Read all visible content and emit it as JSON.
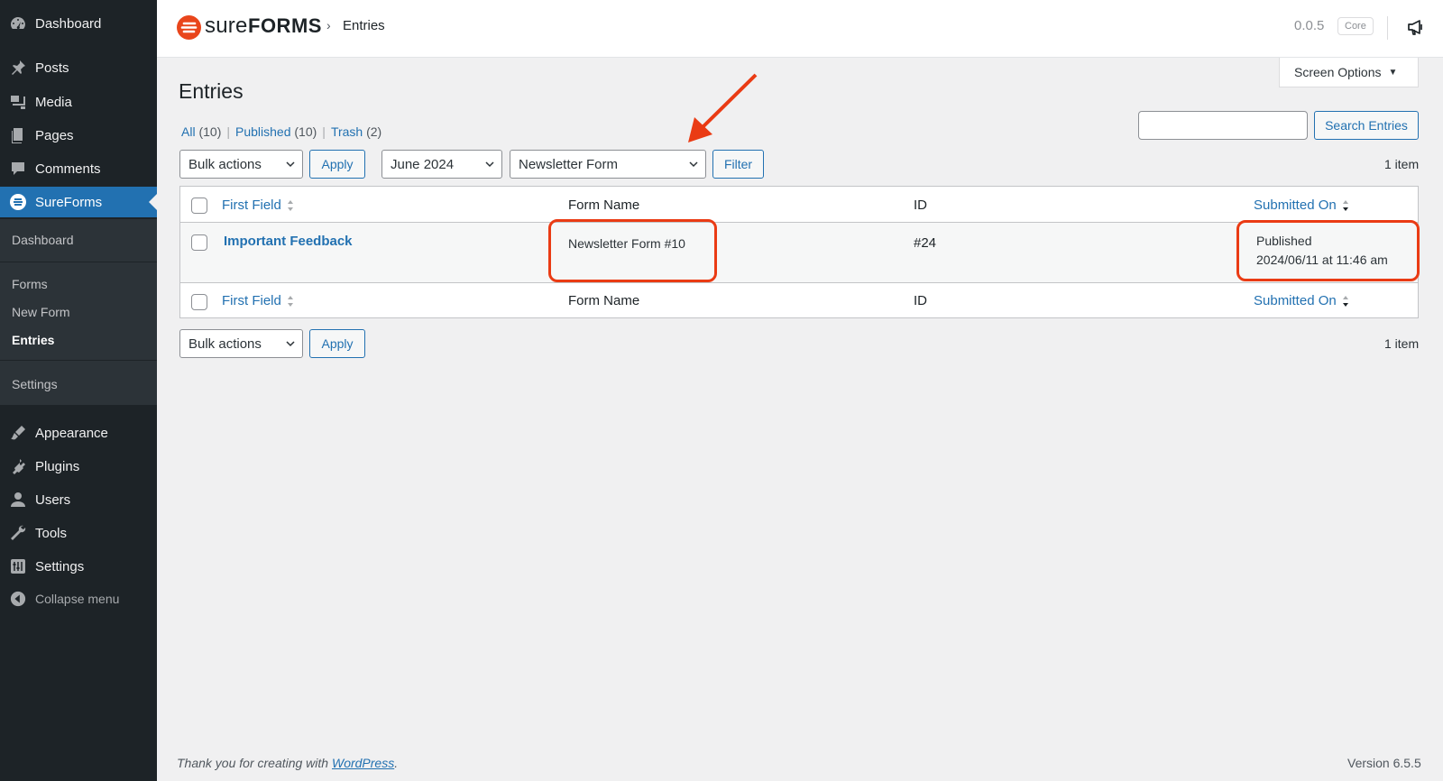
{
  "sidebar": {
    "items": [
      {
        "label": "Dashboard",
        "icon": "dashboard-icon"
      },
      {
        "label": "Posts",
        "icon": "pin-icon"
      },
      {
        "label": "Media",
        "icon": "media-icon"
      },
      {
        "label": "Pages",
        "icon": "pages-icon"
      },
      {
        "label": "Comments",
        "icon": "comment-icon"
      },
      {
        "label": "SureForms",
        "icon": "sureforms-icon"
      },
      {
        "label": "Appearance",
        "icon": "brush-icon"
      },
      {
        "label": "Plugins",
        "icon": "plug-icon"
      },
      {
        "label": "Users",
        "icon": "user-icon"
      },
      {
        "label": "Tools",
        "icon": "wrench-icon"
      },
      {
        "label": "Settings",
        "icon": "settings-icon"
      }
    ],
    "submenu": [
      "Dashboard",
      "Forms",
      "New Form",
      "Entries",
      "Settings"
    ],
    "collapse_label": "Collapse menu"
  },
  "header": {
    "logo_a": "sure",
    "logo_b": "FORMS",
    "breadcrumb_sep": "›",
    "breadcrumb_current": "Entries",
    "version": "0.0.5",
    "badge": "Core"
  },
  "screen_options": "Screen Options",
  "page_title": "Entries",
  "views": {
    "all_label": "All",
    "all_count": "(10)",
    "published_label": "Published",
    "published_count": "(10)",
    "trash_label": "Trash",
    "trash_count": "(2)"
  },
  "toolbar": {
    "bulk_actions": "Bulk actions",
    "apply": "Apply",
    "month": "June 2024",
    "form_filter": "Newsletter Form",
    "filter": "Filter",
    "search_placeholder": "",
    "search_button": "Search Entries",
    "items_count": "1 item"
  },
  "table": {
    "columns": [
      "First Field",
      "Form Name",
      "ID",
      "Submitted On"
    ],
    "rows": [
      {
        "first_field": "Important Feedback",
        "form_name": "Newsletter Form #10",
        "id": "#24",
        "status": "Published",
        "submitted": "2024/06/11 at 11:46 am"
      }
    ]
  },
  "footer": {
    "thanks_prefix": "Thank you for creating with ",
    "thanks_link": "WordPress",
    "thanks_suffix": ".",
    "version": "Version 6.5.5"
  },
  "colors": {
    "accent": "#2271b1",
    "sidebar_bg": "#1d2327",
    "annotation": "#ea3b14",
    "brand": "#e9461c"
  }
}
